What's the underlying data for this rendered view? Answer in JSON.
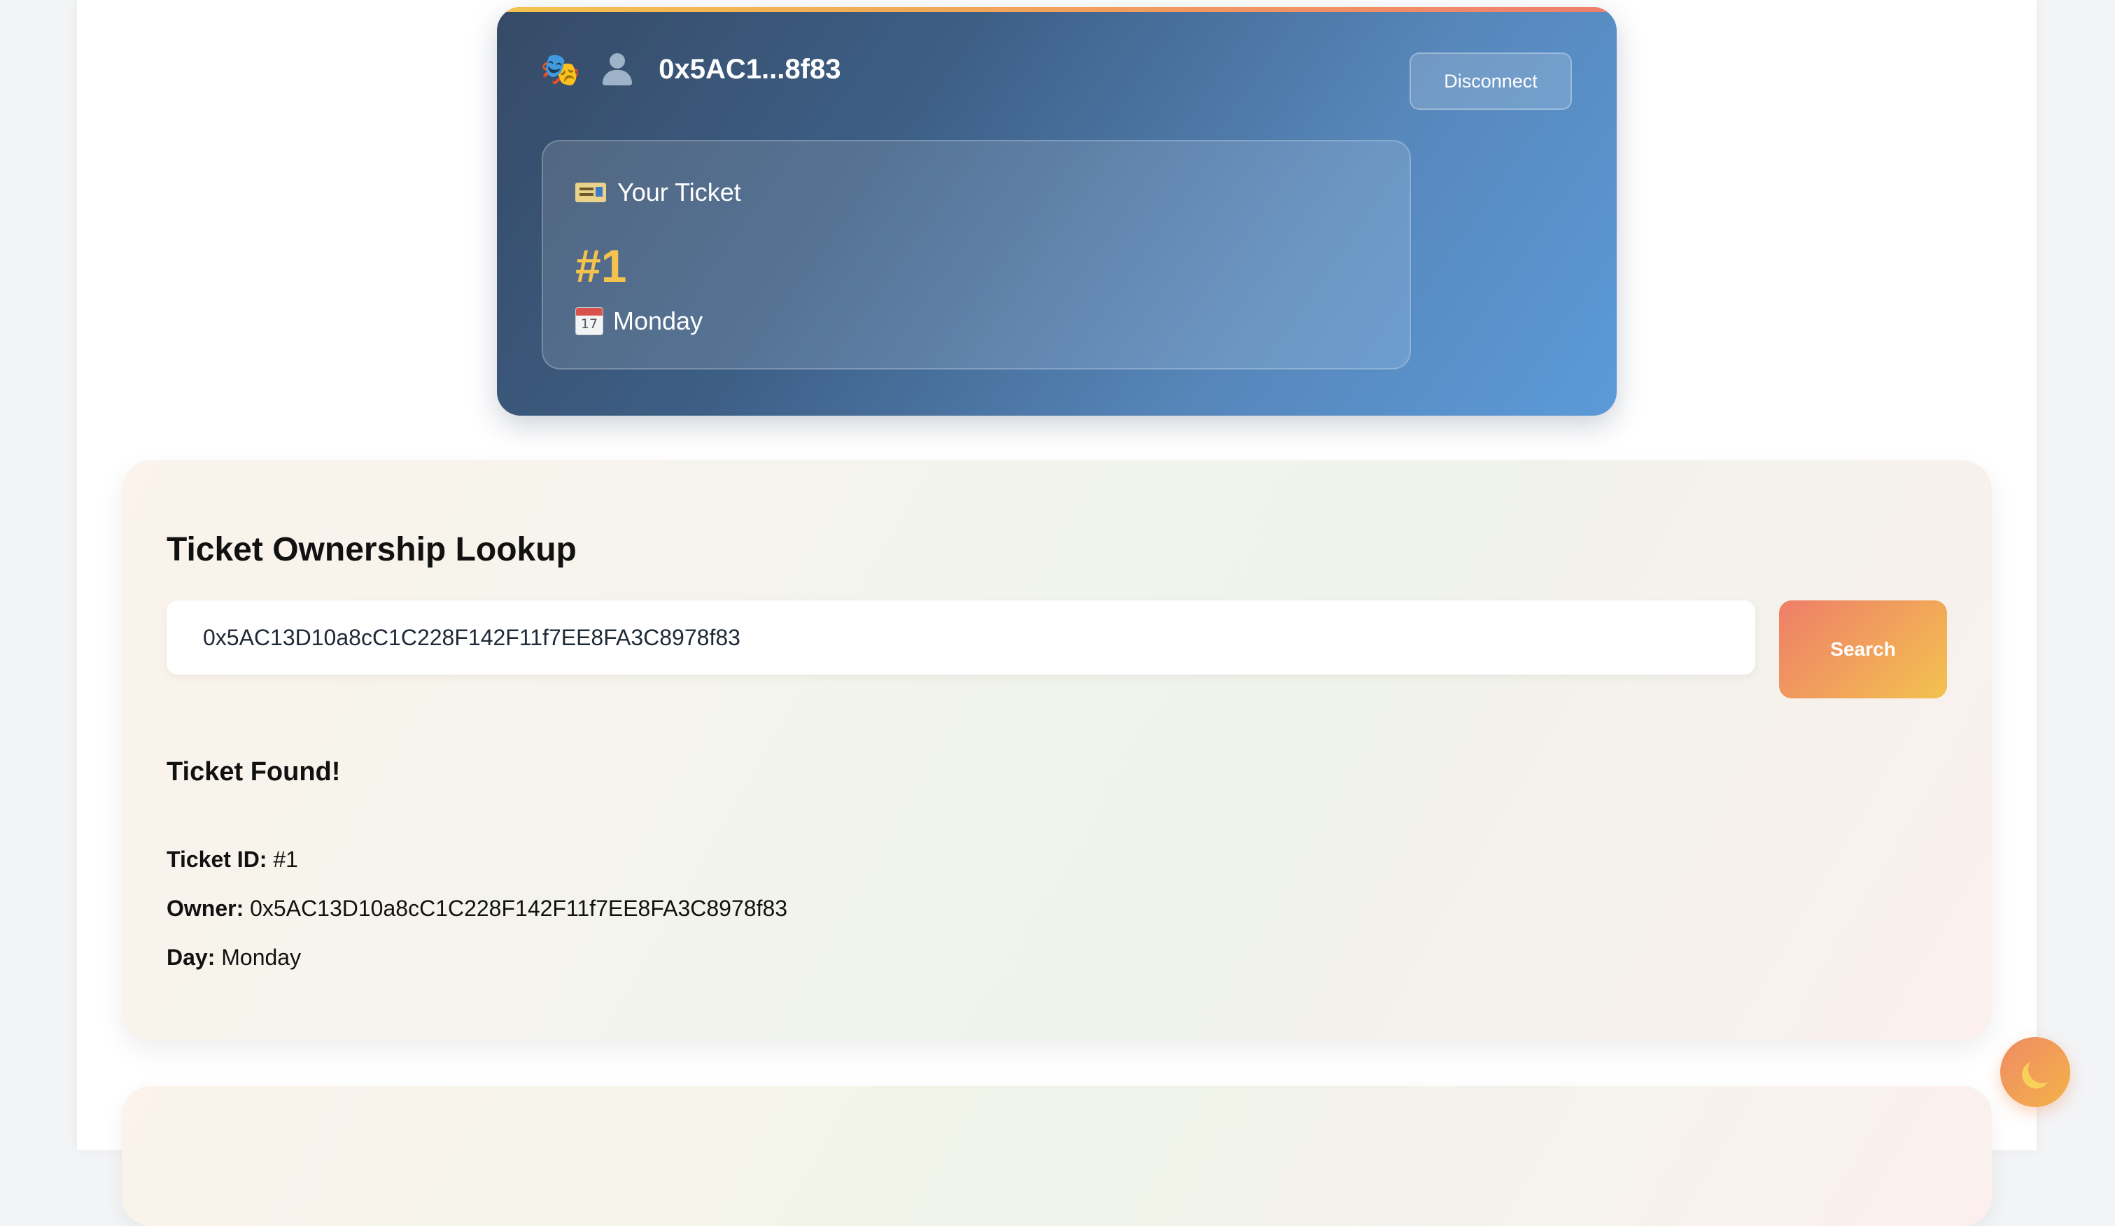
{
  "wallet": {
    "address_short": "0x5AC1...8f83",
    "disconnect_label": "Disconnect",
    "icons": [
      "performing-arts-masks-icon",
      "user-icon"
    ],
    "ticket": {
      "label": "Your Ticket",
      "number": "#1",
      "day": "Monday",
      "icons": [
        "ticket-icon",
        "calendar-icon"
      ],
      "calendar_icon_number": "17"
    }
  },
  "lookup": {
    "title": "Ticket Ownership Lookup",
    "search_value": "0x5AC13D10a8cC1C228F142F11f7EE8FA3C8978f83",
    "search_button_label": "Search",
    "result": {
      "heading": "Ticket Found!",
      "ticket_id_label": "Ticket ID:",
      "ticket_id_value": "#1",
      "owner_label": "Owner:",
      "owner_value": "0x5AC13D10a8cC1C228F142F11f7EE8FA3C8978f83",
      "day_label": "Day:",
      "day_value": "Monday"
    }
  },
  "theme_toggle": {
    "icon": "moon-icon"
  },
  "colors": {
    "accent_gold": "#f4c34e",
    "accent_coral": "#ee7e69",
    "wallet_card_dark": "#364a66",
    "wallet_card_light": "#5b9ad8"
  }
}
